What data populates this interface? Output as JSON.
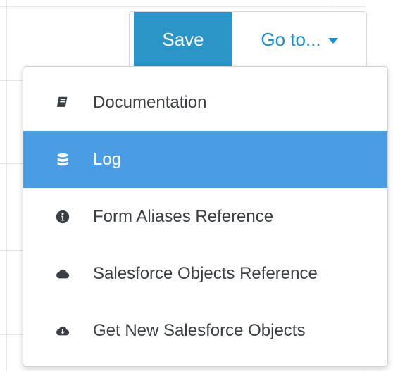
{
  "toolbar": {
    "save_label": "Save",
    "goto_label": "Go to..."
  },
  "menu": {
    "items": [
      {
        "label": "Documentation",
        "icon": "book-icon",
        "active": false
      },
      {
        "label": "Log",
        "icon": "database-icon",
        "active": true
      },
      {
        "label": "Form Aliases Reference",
        "icon": "info-circle-icon",
        "active": false
      },
      {
        "label": "Salesforce Objects Reference",
        "icon": "cloud-icon",
        "active": false
      },
      {
        "label": "Get New Salesforce Objects",
        "icon": "cloud-download-icon",
        "active": false
      }
    ]
  },
  "colors": {
    "save_bg": "#2a95c6",
    "goto_text": "#1f8ecb",
    "active_bg": "#4a9de2",
    "menu_text": "#3a3f45"
  }
}
